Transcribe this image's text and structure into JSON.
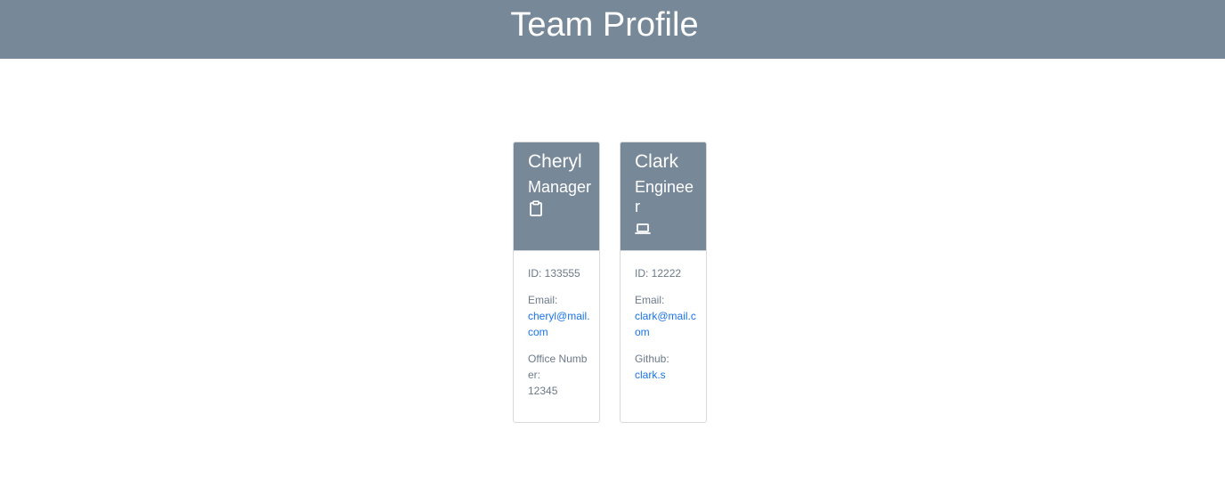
{
  "header": {
    "title": "Team Profile"
  },
  "cards": [
    {
      "name": "Cheryl",
      "role": "Manager",
      "icon": "clipboard-icon",
      "id_text": "ID: 133555",
      "email_label": "Email:",
      "email": "cheryl@mail.com",
      "extra_label": "Office Number:",
      "extra_value": "12345"
    },
    {
      "name": "Clark",
      "role": "Engineer",
      "icon": "laptop-icon",
      "id_text": "ID: 12222",
      "email_label": "Email:",
      "email": "clark@mail.com",
      "extra_label": "Github:",
      "extra_value": "clark.s"
    }
  ],
  "colors": {
    "header_bg": "#778899",
    "link": "#1a73e8",
    "text_muted": "#6c7a89"
  }
}
